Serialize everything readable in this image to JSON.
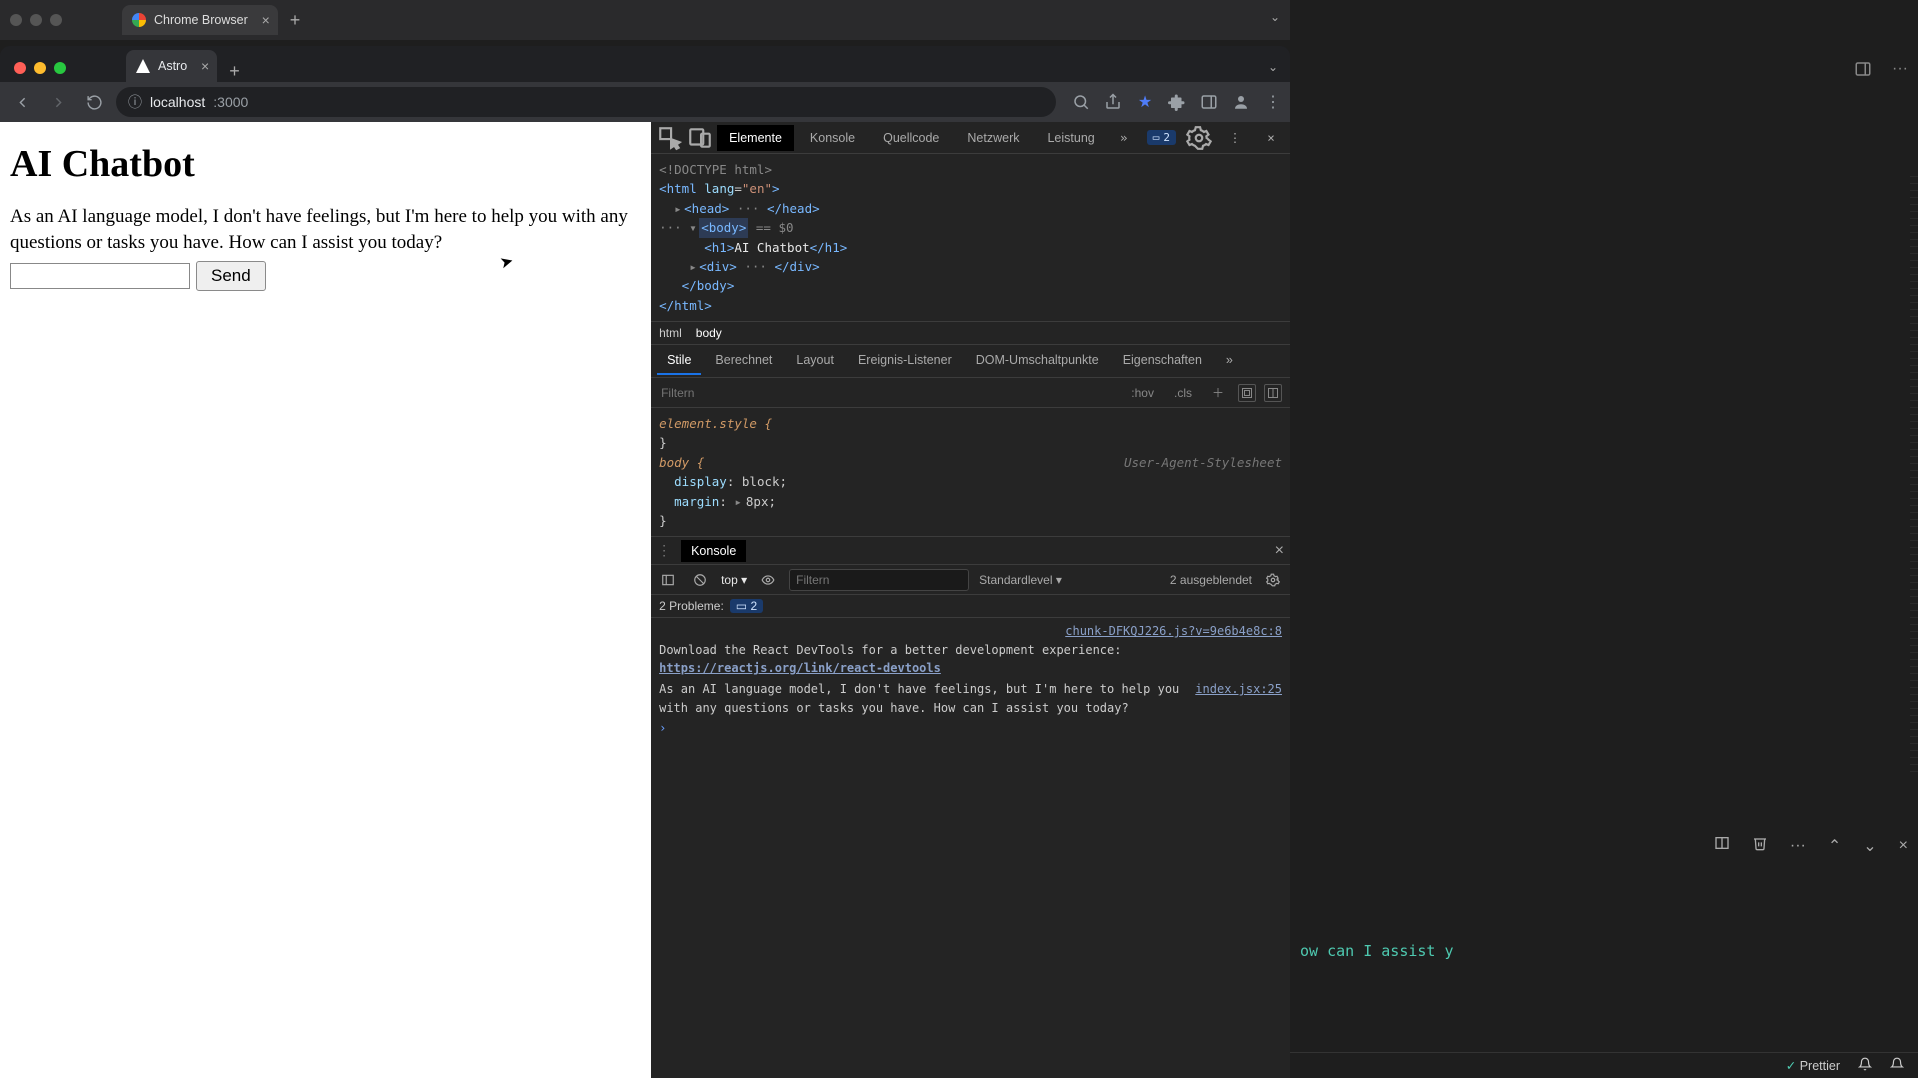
{
  "outer": {
    "tab_title": "Chrome Browser"
  },
  "chrome": {
    "tab_title": "Astro",
    "url_host": "localhost",
    "url_path": ":3000"
  },
  "page": {
    "heading": "AI Chatbot",
    "message": "As an AI language model, I don't have feelings, but I'm here to help you with any questions or tasks you have. How can I assist you today?",
    "input_value": "",
    "send_label": "Send"
  },
  "devtools": {
    "tabs": {
      "elements": "Elemente",
      "console": "Konsole",
      "sources": "Quellcode",
      "network": "Netzwerk",
      "performance": "Leistung"
    },
    "issues_count": "2",
    "dom": {
      "doctype": "<!DOCTYPE html>",
      "html_open": "<html lang=\"en\">",
      "head": "<head> ··· </head>",
      "body_open": "<body>",
      "body_marker": "== $0",
      "h1_open": "<h1>",
      "h1_text": "AI Chatbot",
      "h1_close": "</h1>",
      "div": "<div> ··· </div>",
      "body_close": "</body>",
      "html_close": "</html>"
    },
    "breadcrumb": {
      "a": "html",
      "b": "body"
    },
    "styles_tabs": {
      "styles": "Stile",
      "computed": "Berechnet",
      "layout": "Layout",
      "listeners": "Ereignis-Listener",
      "dom_bp": "DOM-Umschaltpunkte",
      "properties": "Eigenschaften"
    },
    "styles_filter_placeholder": "Filtern",
    "hov": ":hov",
    "cls": ".cls",
    "styles": {
      "elstyle": "element.style {",
      "close": "}",
      "body_sel": "body {",
      "ua_label": "User-Agent-Stylesheet",
      "display_prop": "display",
      "display_val": "block;",
      "margin_prop": "margin",
      "margin_val": "8px;"
    },
    "drawer": {
      "tab_label": "Konsole",
      "context": "top",
      "filter_placeholder": "Filtern",
      "level_label": "Standardlevel",
      "hidden_label": "2 ausgeblendet",
      "problems_label": "2 Probleme:",
      "problems_count": "2",
      "log1_src": "chunk-DFKQJ226.js?v=9e6b4e8c:8",
      "log1_a": "Download the React DevTools for a better development experience: ",
      "log1_link": "https://reactjs.org/link/react-devtools",
      "log2_src": "index.jsx:25",
      "log2_text": "As an AI language model, I don't have feelings, but I'm here to help you with any questions or tasks you have. How can I assist you today?"
    }
  },
  "vscode": {
    "term_fragment": "ow can I assist y",
    "status_prettier": "Prettier"
  }
}
